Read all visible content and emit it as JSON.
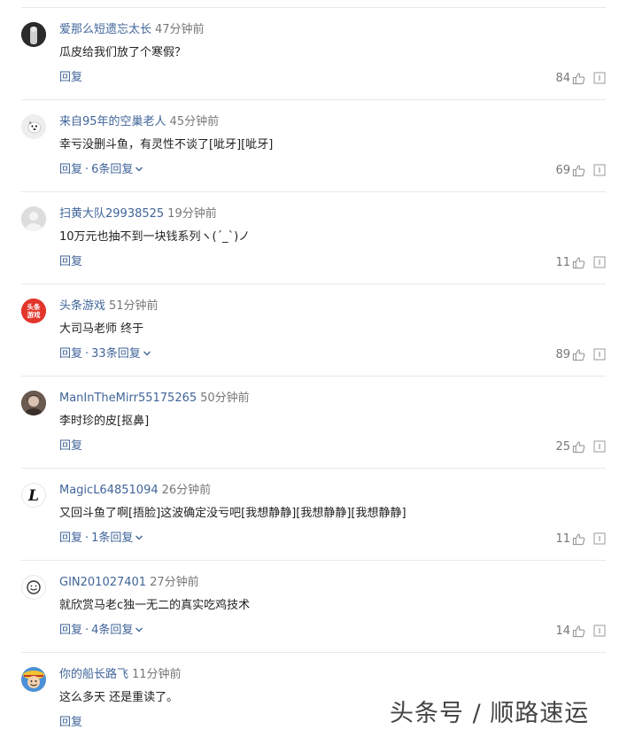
{
  "comments": [
    {
      "username": "爱那么短遗忘太长",
      "time": "47分钟前",
      "content": "瓜皮给我们放了个寒假？",
      "reply_label": "回复",
      "replies_label": "",
      "likes": "84",
      "avatar_color": "#3a3a3a",
      "avatar_icon": "person-photo-icon"
    },
    {
      "username": "来自95年的空巢老人",
      "time": "45分钟前",
      "content": "幸亏没删斗鱼，有灵性不谈了[呲牙][呲牙]",
      "reply_label": "回复",
      "replies_label": "6条回复",
      "likes": "69",
      "avatar_color": "#eeeeee",
      "avatar_icon": "dog-icon"
    },
    {
      "username": "扫黄大队29938525",
      "time": "19分钟前",
      "content": "10万元也抽不到一块钱系列ヽ(ˊ_ˋ)ノ",
      "reply_label": "回复",
      "replies_label": "",
      "likes": "11",
      "avatar_color": "#d8d8d8",
      "avatar_icon": "default-user-icon"
    },
    {
      "username": "头条游戏",
      "time": "51分钟前",
      "content": "大司马老师 终于",
      "reply_label": "回复",
      "replies_label": "33条回复",
      "likes": "89",
      "avatar_color": "#e3352b",
      "avatar_icon": "toutiao-game-logo-icon",
      "avatar_text": "头条\n游戏"
    },
    {
      "username": "ManInTheMirr55175265",
      "time": "50分钟前",
      "content": "李时珍的皮[抠鼻]",
      "reply_label": "回复",
      "replies_label": "",
      "likes": "25",
      "avatar_color": "#5a4a42",
      "avatar_icon": "person-photo-icon"
    },
    {
      "username": "MagicL64851094",
      "time": "26分钟前",
      "content": "又回斗鱼了啊[捂脸]这波确定没亏吧[我想静静][我想静静][我想静静]",
      "reply_label": "回复",
      "replies_label": "1条回复",
      "likes": "11",
      "avatar_color": "#ffffff",
      "avatar_icon": "letter-l-icon",
      "avatar_text": "L"
    },
    {
      "username": "GIN201027401",
      "time": "27分钟前",
      "content": "就欣赏马老c独一无二的真实吃鸡技术",
      "reply_label": "回复",
      "replies_label": "4条回复",
      "likes": "14",
      "avatar_color": "#ffffff",
      "avatar_icon": "smiley-face-icon"
    },
    {
      "username": "你的船长路飞",
      "time": "11分钟前",
      "content": "这么多天 还是重读了。",
      "reply_label": "回复",
      "replies_label": "",
      "likes": "",
      "avatar_color": "#f2b233",
      "avatar_icon": "luffy-avatar-icon"
    }
  ],
  "separator": "·",
  "watermark": "头条号 / 顺路速运",
  "colors": {
    "link": "#406599",
    "muted": "#777777",
    "divider": "#e8e8e8"
  }
}
